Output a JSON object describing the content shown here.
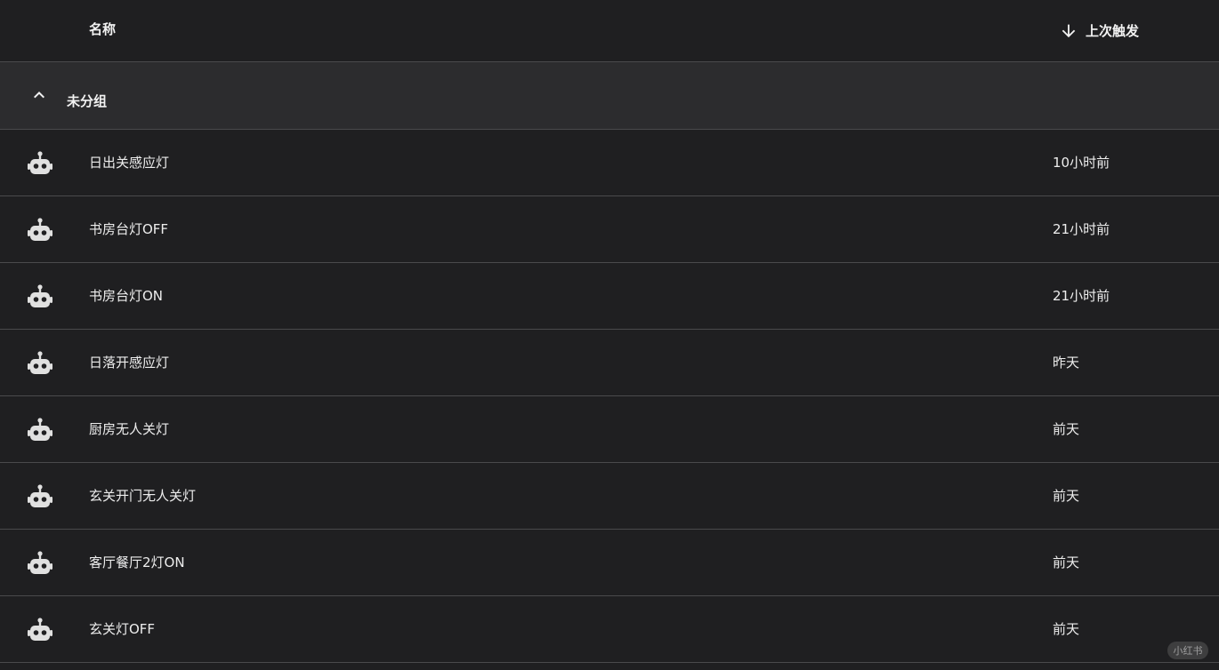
{
  "header": {
    "name_label": "名称",
    "sort_icon": "arrow-down-icon",
    "trigger_label": "上次触发"
  },
  "group": {
    "label": "未分组",
    "icon": "chevron-up-icon",
    "expanded": true
  },
  "automations": [
    {
      "name": "日出关感应灯",
      "last_triggered": "10小时前",
      "icon": "robot-icon"
    },
    {
      "name": "书房台灯OFF",
      "last_triggered": "21小时前",
      "icon": "robot-icon"
    },
    {
      "name": "书房台灯ON",
      "last_triggered": "21小时前",
      "icon": "robot-icon"
    },
    {
      "name": "日落开感应灯",
      "last_triggered": "昨天",
      "icon": "robot-icon"
    },
    {
      "name": "厨房无人关灯",
      "last_triggered": "前天",
      "icon": "robot-icon"
    },
    {
      "name": "玄关开门无人关灯",
      "last_triggered": "前天",
      "icon": "robot-icon"
    },
    {
      "name": "客厅餐厅2灯ON",
      "last_triggered": "前天",
      "icon": "robot-icon"
    },
    {
      "name": "玄关灯OFF",
      "last_triggered": "前天",
      "icon": "robot-icon"
    }
  ],
  "watermark": "小红书",
  "colors": {
    "background": "#1f1f21",
    "group_background": "#2c2c2e",
    "divider": "#4a4a4c",
    "text": "#ededed",
    "icon": "#e0e0e0"
  }
}
